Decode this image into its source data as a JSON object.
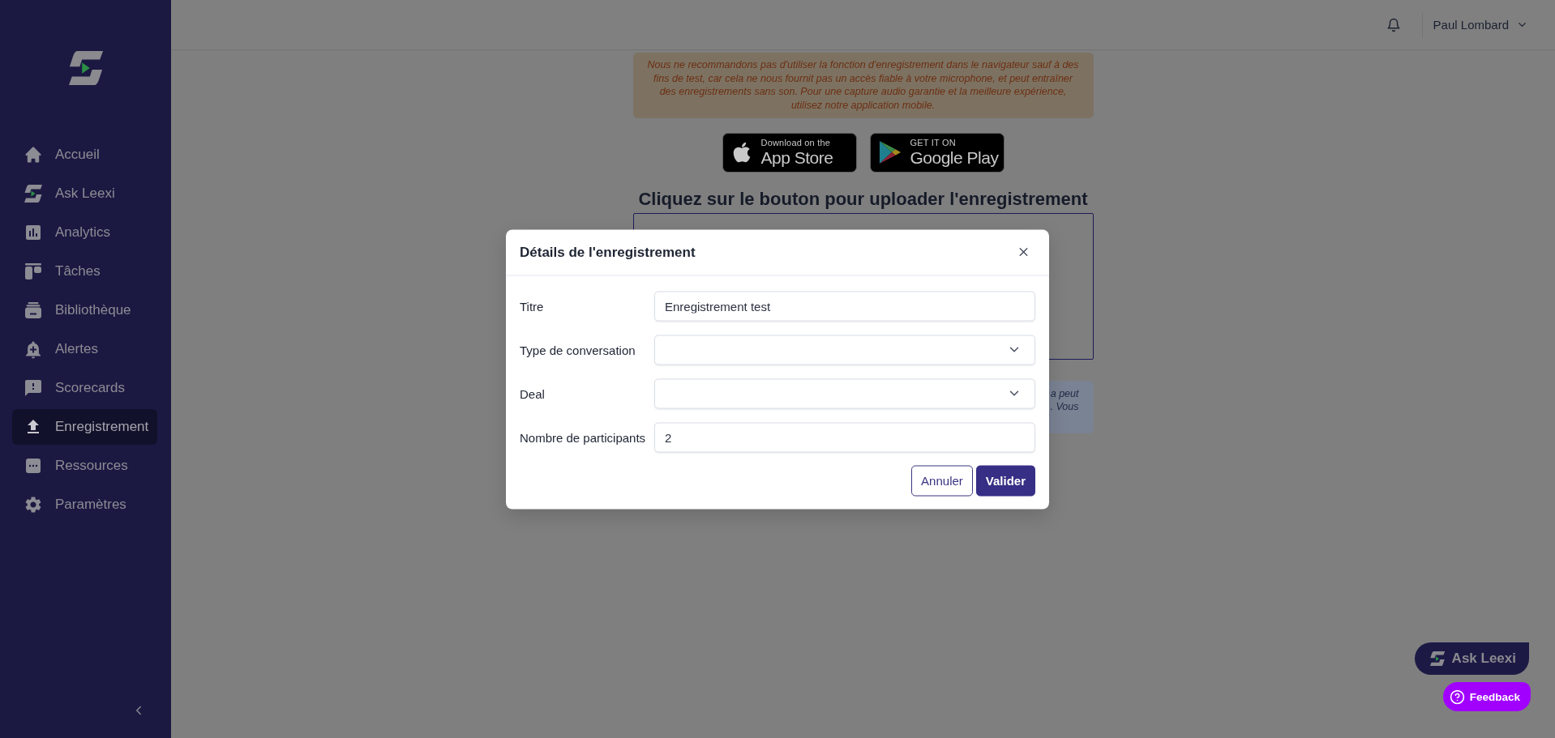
{
  "sidebar": {
    "items": [
      {
        "label": "Accueil",
        "selected": false
      },
      {
        "label": "Ask Leexi",
        "selected": false
      },
      {
        "label": "Analytics",
        "selected": false
      },
      {
        "label": "Tâches",
        "selected": false
      },
      {
        "label": "Bibliothèque",
        "selected": false
      },
      {
        "label": "Alertes",
        "selected": false
      },
      {
        "label": "Scorecards",
        "selected": false
      },
      {
        "label": "Enregistrement",
        "selected": true
      },
      {
        "label": "Ressources",
        "selected": false
      },
      {
        "label": "Paramètres",
        "selected": false
      }
    ]
  },
  "header": {
    "user_name": "Paul Lombard"
  },
  "notice": {
    "text": "Nous ne recommandons pas d'utiliser la fonction d'enregistrement dans le navigateur sauf à des fins de test, car cela ne nous fournit pas un accès fiable à votre microphone, et peut entraîner des enregistrements sans son. Pour une capture audio garantie et la meilleure expérience, utilisez notre application mobile."
  },
  "store_badges": [
    {
      "caption": "Download on the",
      "name": "App Store"
    },
    {
      "caption": "GET IT ON",
      "name": "Google Play"
    }
  ],
  "upload": {
    "heading": "Cliquez sur le bouton pour uploader l'enregistrement"
  },
  "info_box": {
    "lines": [
      "a peut",
      ". Vous"
    ]
  },
  "modal": {
    "title": "Détails de l'enregistrement",
    "fields": [
      {
        "label": "Titre",
        "kind": "text",
        "value": "Enregistrement test"
      },
      {
        "label": "Type de conversation",
        "kind": "select"
      },
      {
        "label": "Deal",
        "kind": "select"
      },
      {
        "label": "Nombre de participants",
        "kind": "text",
        "value": "2"
      }
    ],
    "buttons": [
      {
        "label": "Annuler",
        "kind": "secondary"
      },
      {
        "label": "Valider",
        "kind": "primary"
      }
    ]
  },
  "ask_button": {
    "label": "Ask Leexi"
  },
  "feedback_button": {
    "label": "Feedback"
  }
}
